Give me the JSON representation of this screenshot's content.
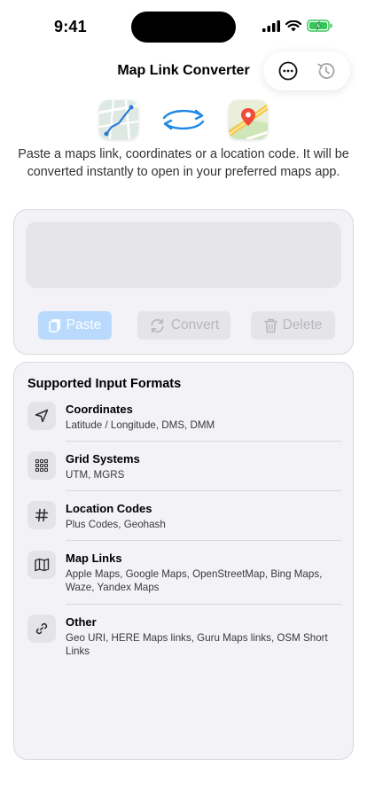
{
  "status_bar": {
    "time": "9:41"
  },
  "header": {
    "title": "Map Link Converter",
    "more_icon": "ellipsis-circle-icon",
    "history_icon": "history-clock-icon"
  },
  "hero": {
    "left_app_icon": "route-map-app-icon",
    "arrows_icon": "swap-arrows-icon",
    "right_app_icon": "apple-maps-app-icon",
    "description": "Paste a maps link, coordinates or a location code. It will be converted instantly to open in your preferred maps app."
  },
  "input": {
    "value": "",
    "placeholder": "",
    "paste_label": "Paste",
    "convert_label": "Convert",
    "delete_label": "Delete",
    "colors": {
      "accent": "#007aff",
      "paste_bg": "#b9dafd",
      "disabled_bg": "#e4e4e9"
    }
  },
  "formats": {
    "title": "Supported Input Formats",
    "items": [
      {
        "name": "Coordinates",
        "desc": "Latitude / Longitude, DMS, DMM",
        "icon": "location-arrow-icon"
      },
      {
        "name": "Grid Systems",
        "desc": "UTM, MGRS",
        "icon": "grid-icon"
      },
      {
        "name": "Location Codes",
        "desc": "Plus Codes, Geohash",
        "icon": "hash-icon"
      },
      {
        "name": "Map Links",
        "desc": "Apple Maps, Google Maps, OpenStreetMap, Bing Maps, Waze, Yandex Maps",
        "icon": "folded-map-icon"
      },
      {
        "name": "Other",
        "desc": "Geo URI, HERE Maps links, Guru Maps links, OSM Short Links",
        "icon": "link-icon"
      }
    ]
  }
}
